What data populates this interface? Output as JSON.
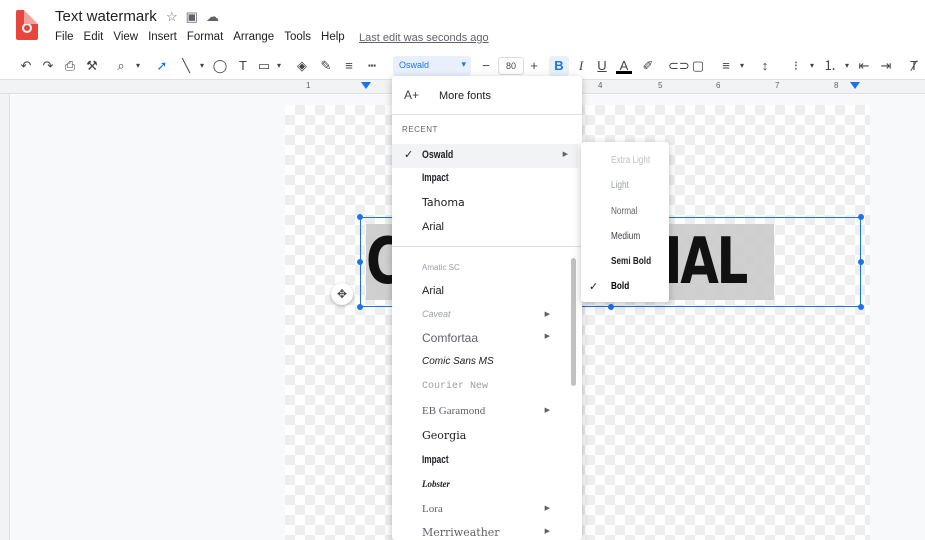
{
  "header": {
    "doc_title": "Text watermark",
    "menu": [
      "File",
      "Edit",
      "View",
      "Insert",
      "Format",
      "Arrange",
      "Tools",
      "Help"
    ],
    "last_edit": "Last edit was seconds ago",
    "star_icon": "star-icon",
    "folder_icon": "move-to-folder-icon",
    "cloud_icon": "cloud-status-icon"
  },
  "toolbar": {
    "font_name": "Oswald",
    "font_size": "80",
    "minus": "−",
    "plus": "+",
    "bold": "B",
    "italic": "I",
    "underline": "U"
  },
  "ruler": {
    "numbers": [
      "1",
      "4",
      "5",
      "6",
      "7",
      "8"
    ]
  },
  "canvas": {
    "word_left": "C",
    "word_right": "IAL"
  },
  "font_menu": {
    "more_fonts": "More fonts",
    "recent_label": "RECENT",
    "recent": [
      {
        "name": "Oswald",
        "checked": true,
        "submenu": true
      },
      {
        "name": "Impact",
        "checked": false,
        "submenu": false
      },
      {
        "name": "Tahoma",
        "checked": false,
        "submenu": false
      },
      {
        "name": "Arial",
        "checked": false,
        "submenu": false
      }
    ],
    "all": [
      {
        "name": "Amatic SC",
        "submenu": false
      },
      {
        "name": "Arial",
        "submenu": false
      },
      {
        "name": "Caveat",
        "submenu": true
      },
      {
        "name": "Comfortaa",
        "submenu": true
      },
      {
        "name": "Comic Sans MS",
        "submenu": false
      },
      {
        "name": "Courier New",
        "submenu": false
      },
      {
        "name": "EB Garamond",
        "submenu": true
      },
      {
        "name": "Georgia",
        "submenu": false
      },
      {
        "name": "Impact",
        "submenu": false
      },
      {
        "name": "Lobster",
        "submenu": false
      },
      {
        "name": "Lora",
        "submenu": true
      },
      {
        "name": "Merriweather",
        "submenu": true
      }
    ]
  },
  "weight_menu": {
    "items": [
      {
        "name": "Extra Light",
        "checked": false
      },
      {
        "name": "Light",
        "checked": false
      },
      {
        "name": "Normal",
        "checked": false
      },
      {
        "name": "Medium",
        "checked": false
      },
      {
        "name": "Semi Bold",
        "checked": false
      },
      {
        "name": "Bold",
        "checked": true
      }
    ]
  },
  "colors": {
    "accent": "#1a73e8",
    "doc_icon": "#e8453c"
  }
}
